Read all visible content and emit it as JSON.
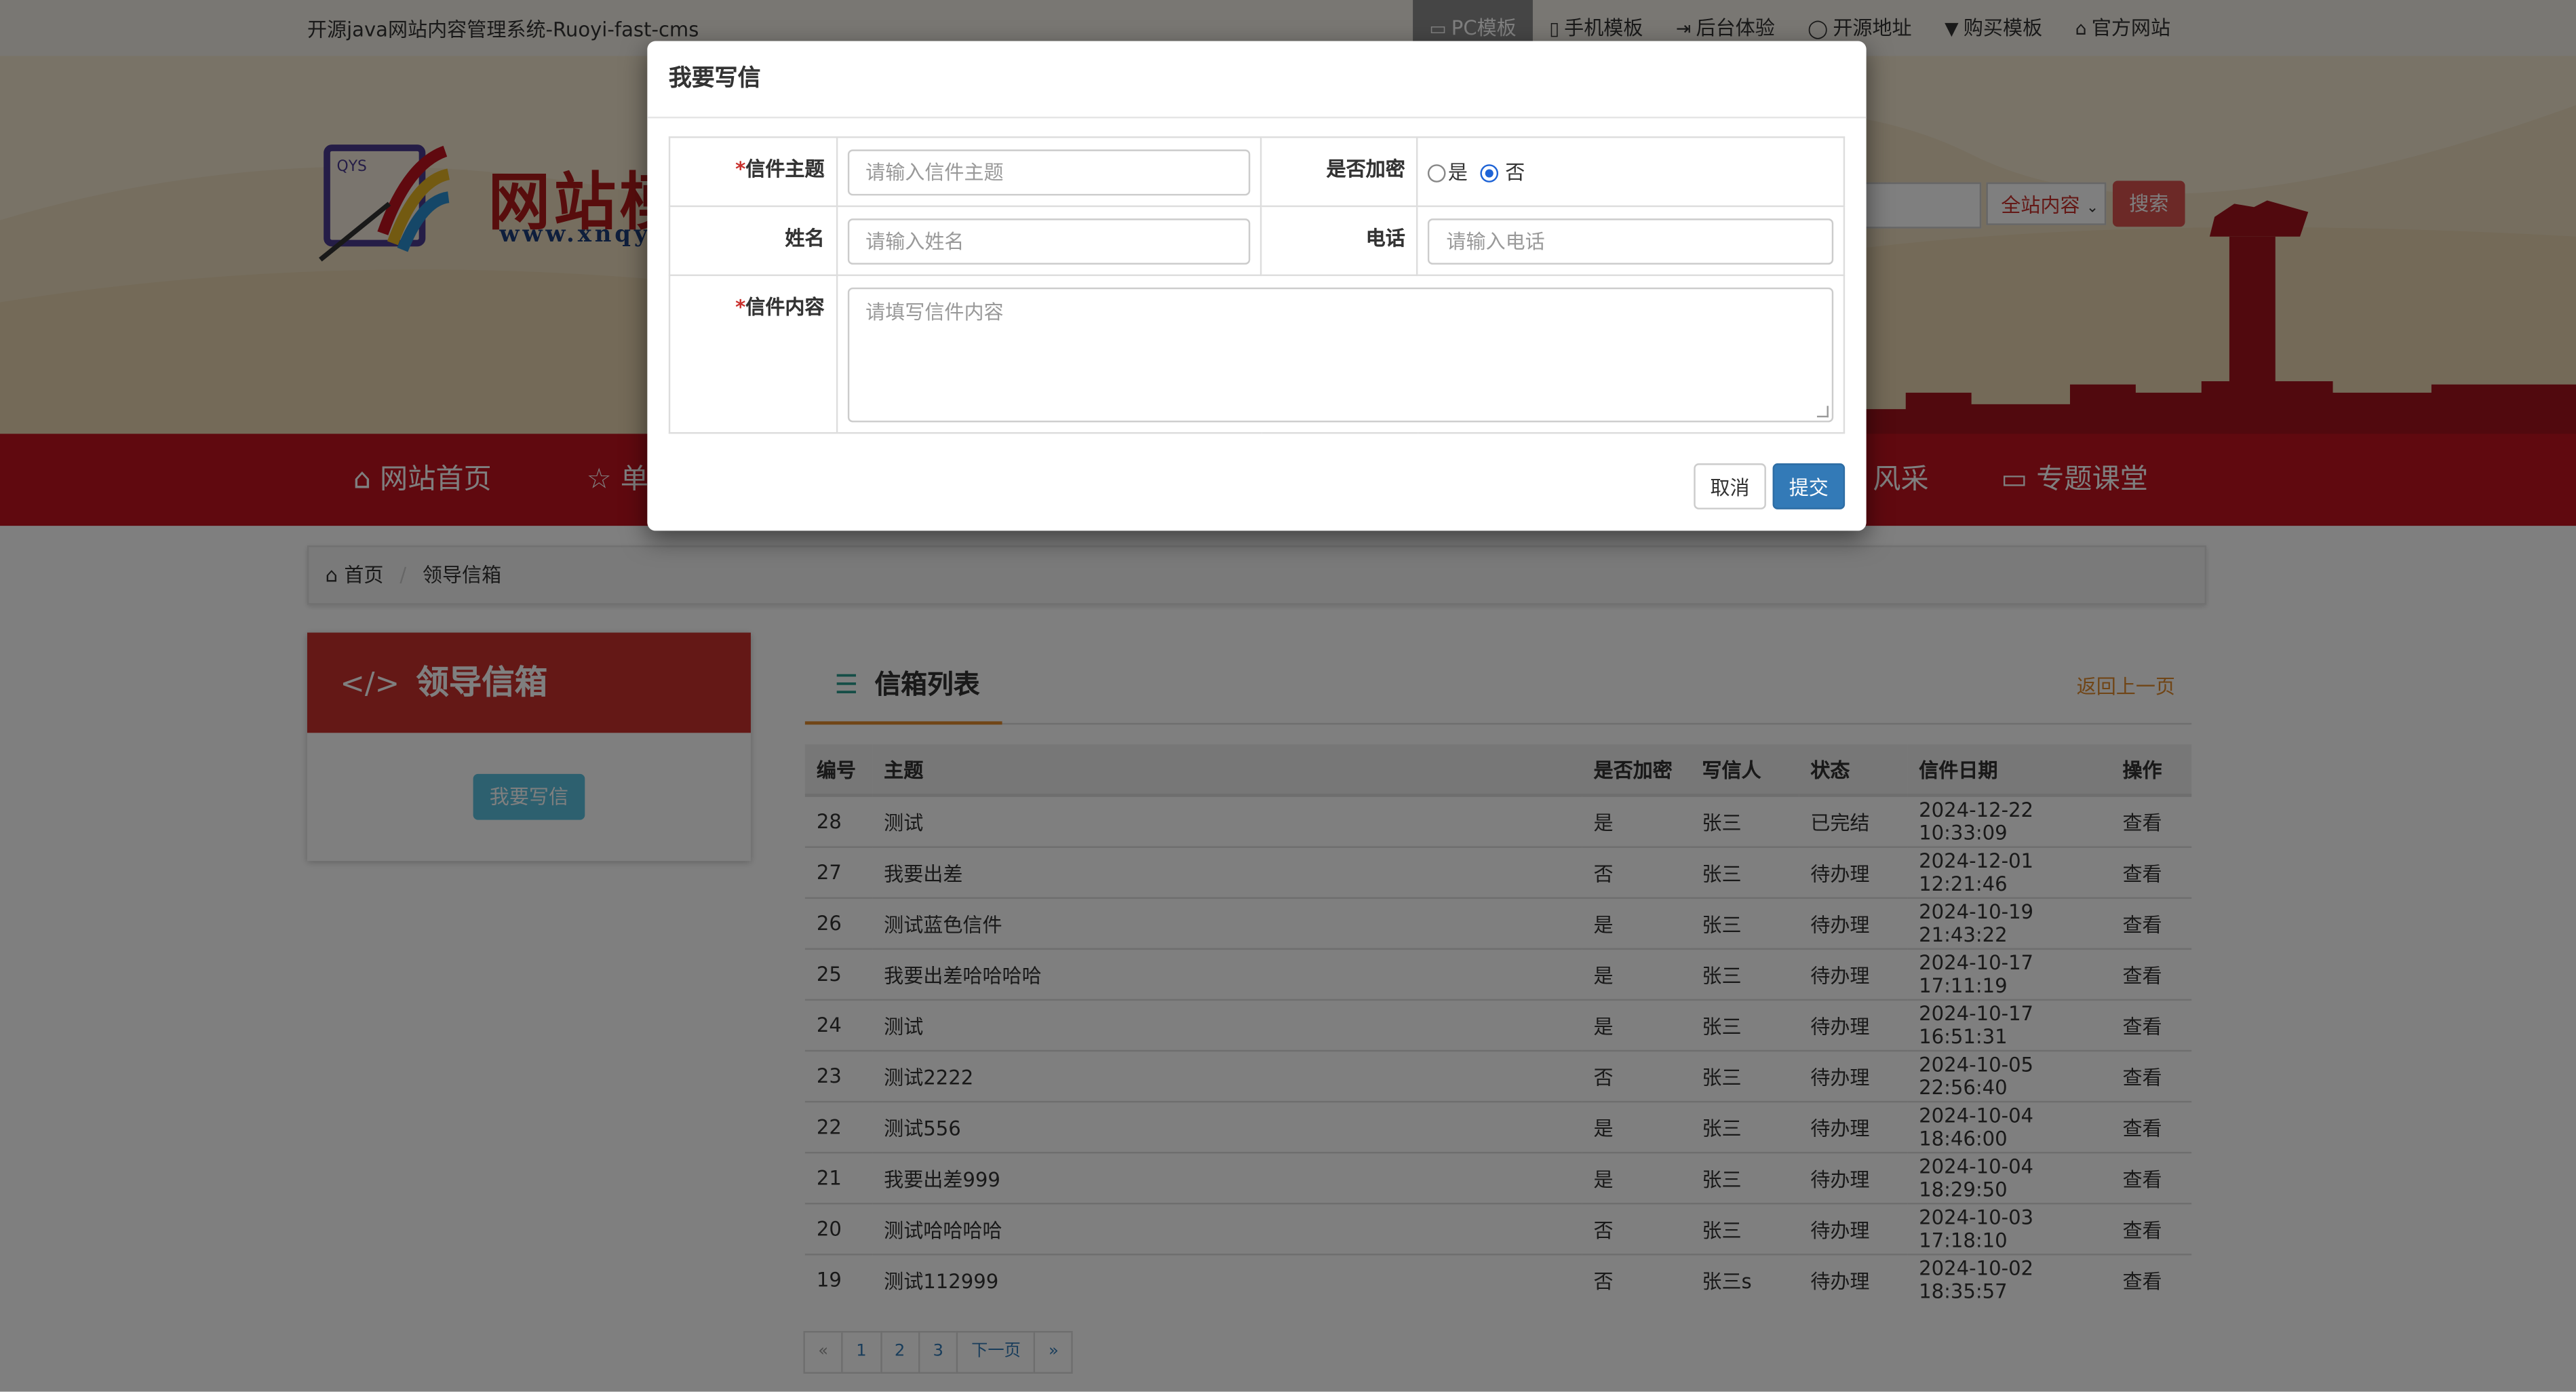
{
  "site_title": "开源java网站内容管理系统-Ruoyi-fast-cms",
  "toplinks": [
    {
      "label": "PC模板",
      "active": true
    },
    {
      "label": "手机模板",
      "active": false
    },
    {
      "label": "后台体验",
      "active": false
    },
    {
      "label": "开源地址",
      "active": false
    },
    {
      "label": "购买模板",
      "active": false
    },
    {
      "label": "官方网站",
      "active": false
    }
  ],
  "logo": {
    "badge": "QYS",
    "title": "网站模",
    "url": "www.xnqy"
  },
  "search": {
    "scope": "全站内容",
    "button": "搜索"
  },
  "nav": {
    "home": "网站首页",
    "single": "单",
    "style": "风采",
    "topic": "专题课堂"
  },
  "breadcrumb": {
    "home": "首页",
    "current": "领导信箱"
  },
  "sidebar": {
    "title": "领导信箱",
    "write_button": "我要写信"
  },
  "list": {
    "title": "信箱列表",
    "back": "返回上一页",
    "headers": [
      "编号",
      "主题",
      "是否加密",
      "写信人",
      "状态",
      "信件日期",
      "操作"
    ],
    "rows": [
      {
        "id": "28",
        "subject": "测试",
        "enc": "是",
        "writer": "张三",
        "status": "已完结",
        "date": "2024-12-22 10:33:09",
        "action": "查看"
      },
      {
        "id": "27",
        "subject": "我要出差",
        "enc": "否",
        "writer": "张三",
        "status": "待办理",
        "date": "2024-12-01 12:21:46",
        "action": "查看"
      },
      {
        "id": "26",
        "subject": "测试蓝色信件",
        "enc": "是",
        "writer": "张三",
        "status": "待办理",
        "date": "2024-10-19 21:43:22",
        "action": "查看"
      },
      {
        "id": "25",
        "subject": "我要出差哈哈哈哈",
        "enc": "是",
        "writer": "张三",
        "status": "待办理",
        "date": "2024-10-17 17:11:19",
        "action": "查看"
      },
      {
        "id": "24",
        "subject": "测试",
        "enc": "是",
        "writer": "张三",
        "status": "待办理",
        "date": "2024-10-17 16:51:31",
        "action": "查看"
      },
      {
        "id": "23",
        "subject": "测试2222",
        "enc": "否",
        "writer": "张三",
        "status": "待办理",
        "date": "2024-10-05 22:56:40",
        "action": "查看"
      },
      {
        "id": "22",
        "subject": "测试556",
        "enc": "是",
        "writer": "张三",
        "status": "待办理",
        "date": "2024-10-04 18:46:00",
        "action": "查看"
      },
      {
        "id": "21",
        "subject": "我要出差999",
        "enc": "是",
        "writer": "张三",
        "status": "待办理",
        "date": "2024-10-04 18:29:50",
        "action": "查看"
      },
      {
        "id": "20",
        "subject": "测试哈哈哈哈",
        "enc": "否",
        "writer": "张三",
        "status": "待办理",
        "date": "2024-10-03 17:18:10",
        "action": "查看"
      },
      {
        "id": "19",
        "subject": "测试112999",
        "enc": "否",
        "writer": "张三s",
        "status": "待办理",
        "date": "2024-10-02 18:35:57",
        "action": "查看"
      }
    ]
  },
  "pager": {
    "first": "«",
    "pages": [
      "1",
      "2",
      "3"
    ],
    "next": "下一页",
    "last": "»"
  },
  "modal": {
    "title": "我要写信",
    "subject_label": "信件主题",
    "subject_placeholder": "请输入信件主题",
    "encrypt_label": "是否加密",
    "encrypt_yes": "是",
    "encrypt_no": "否",
    "name_label": "姓名",
    "name_placeholder": "请输入姓名",
    "phone_label": "电话",
    "phone_placeholder": "请输入电话",
    "content_label": "信件内容",
    "content_placeholder": "请填写信件内容",
    "cancel": "取消",
    "submit": "提交"
  },
  "colors": {
    "nav_red": "#c1121f",
    "accent_orange": "#e08a2c",
    "primary_blue": "#337ab7",
    "info": "#5bc0de"
  }
}
